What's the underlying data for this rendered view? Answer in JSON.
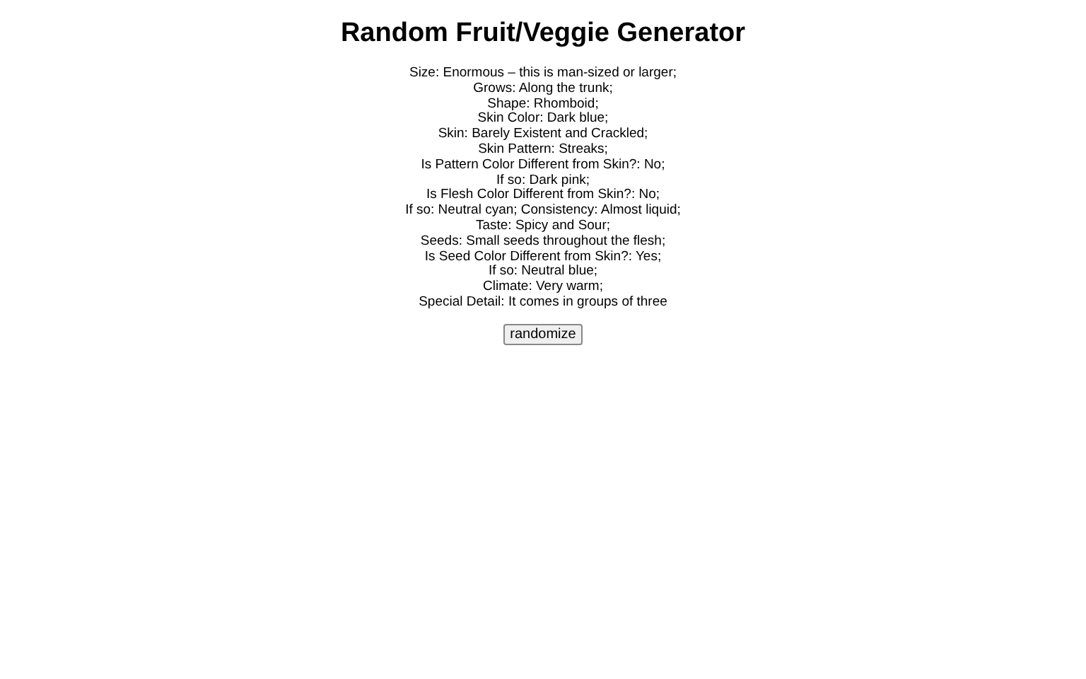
{
  "title": "Random Fruit/Veggie Generator",
  "lines": [
    "Size: Enormous – this is man-sized or larger;",
    "Grows: Along the trunk;",
    "Shape: Rhomboid;",
    "Skin Color: Dark blue;",
    "Skin: Barely Existent and Crackled;",
    "Skin Pattern: Streaks;",
    "Is Pattern Color Different from Skin?: No;",
    "If so: Dark pink;",
    "Is Flesh Color Different from Skin?: No;",
    "If so: Neutral cyan; Consistency: Almost liquid;",
    "Taste: Spicy and Sour;",
    "Seeds: Small seeds throughout the flesh;",
    "Is Seed Color Different from Skin?: Yes;",
    "If so: Neutral blue;",
    "Climate: Very warm;",
    "Special Detail: It comes in groups of three"
  ],
  "button": "randomize"
}
